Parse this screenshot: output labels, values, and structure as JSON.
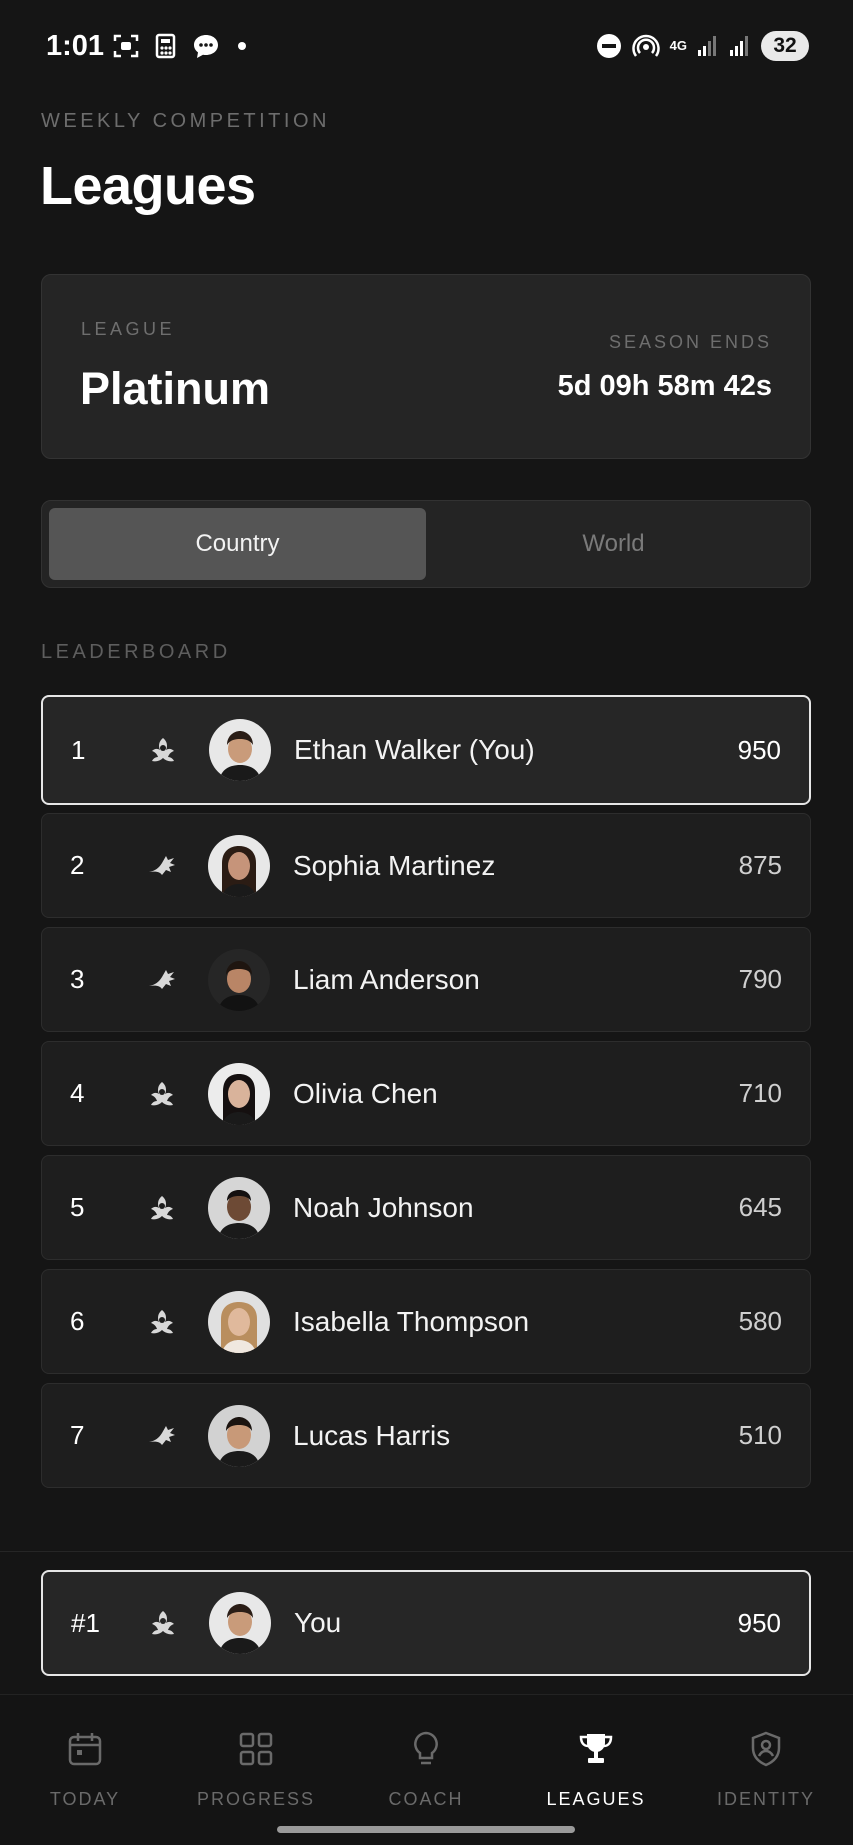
{
  "status_bar": {
    "time": "1:01",
    "network": "4G",
    "battery": "32"
  },
  "header": {
    "eyebrow": "WEEKLY COMPETITION",
    "title": "Leagues"
  },
  "league_card": {
    "label": "LEAGUE",
    "name": "Platinum",
    "season_label": "SEASON ENDS",
    "season_countdown": "5d 09h 58m 42s"
  },
  "scope_toggle": {
    "options": [
      "Country",
      "World"
    ],
    "selected": "Country"
  },
  "leaderboard": {
    "label": "LEADERBOARD",
    "rows": [
      {
        "rank": "1",
        "name": "Ethan Walker (You)",
        "score": "950",
        "is_me": true,
        "emblem": "laurel-emblem-icon",
        "avatar_skin": "#c99b7a",
        "avatar_hair": "#2a1d16"
      },
      {
        "rank": "2",
        "name": "Sophia Martinez",
        "score": "875",
        "is_me": false,
        "emblem": "winged-emblem-icon",
        "avatar_skin": "#c6947a",
        "avatar_hair": "#2b1c14"
      },
      {
        "rank": "3",
        "name": "Liam Anderson",
        "score": "790",
        "is_me": false,
        "emblem": "winged-emblem-icon",
        "avatar_skin": "#b98566",
        "avatar_hair": "#1e1510"
      },
      {
        "rank": "4",
        "name": "Olivia Chen",
        "score": "710",
        "is_me": false,
        "emblem": "laurel-emblem-icon",
        "avatar_skin": "#d9b39b",
        "avatar_hair": "#151010"
      },
      {
        "rank": "5",
        "name": "Noah Johnson",
        "score": "645",
        "is_me": false,
        "emblem": "laurel-emblem-icon",
        "avatar_skin": "#6d4a35",
        "avatar_hair": "#141010"
      },
      {
        "rank": "6",
        "name": "Isabella Thompson",
        "score": "580",
        "is_me": false,
        "emblem": "laurel-emblem-icon",
        "avatar_skin": "#e0b99c",
        "avatar_hair": "#b98e5e"
      },
      {
        "rank": "7",
        "name": "Lucas Harris",
        "score": "510",
        "is_me": false,
        "emblem": "winged-emblem-icon",
        "avatar_skin": "#c89978",
        "avatar_hair": "#1b1410"
      }
    ]
  },
  "my_position": {
    "rank": "#1",
    "name": "You",
    "score": "950"
  },
  "tab_bar": {
    "tabs": [
      {
        "label": "TODAY",
        "icon": "calendar-icon"
      },
      {
        "label": "PROGRESS",
        "icon": "grid-icon"
      },
      {
        "label": "COACH",
        "icon": "lightbulb-icon"
      },
      {
        "label": "LEAGUES",
        "icon": "trophy-icon"
      },
      {
        "label": "IDENTITY",
        "icon": "shield-user-icon"
      }
    ],
    "active": "LEAGUES"
  },
  "colors": {
    "background": "#151515",
    "card": "#252525",
    "highlight_border": "#e6e6e6",
    "muted_text": "#6e6e6e"
  }
}
